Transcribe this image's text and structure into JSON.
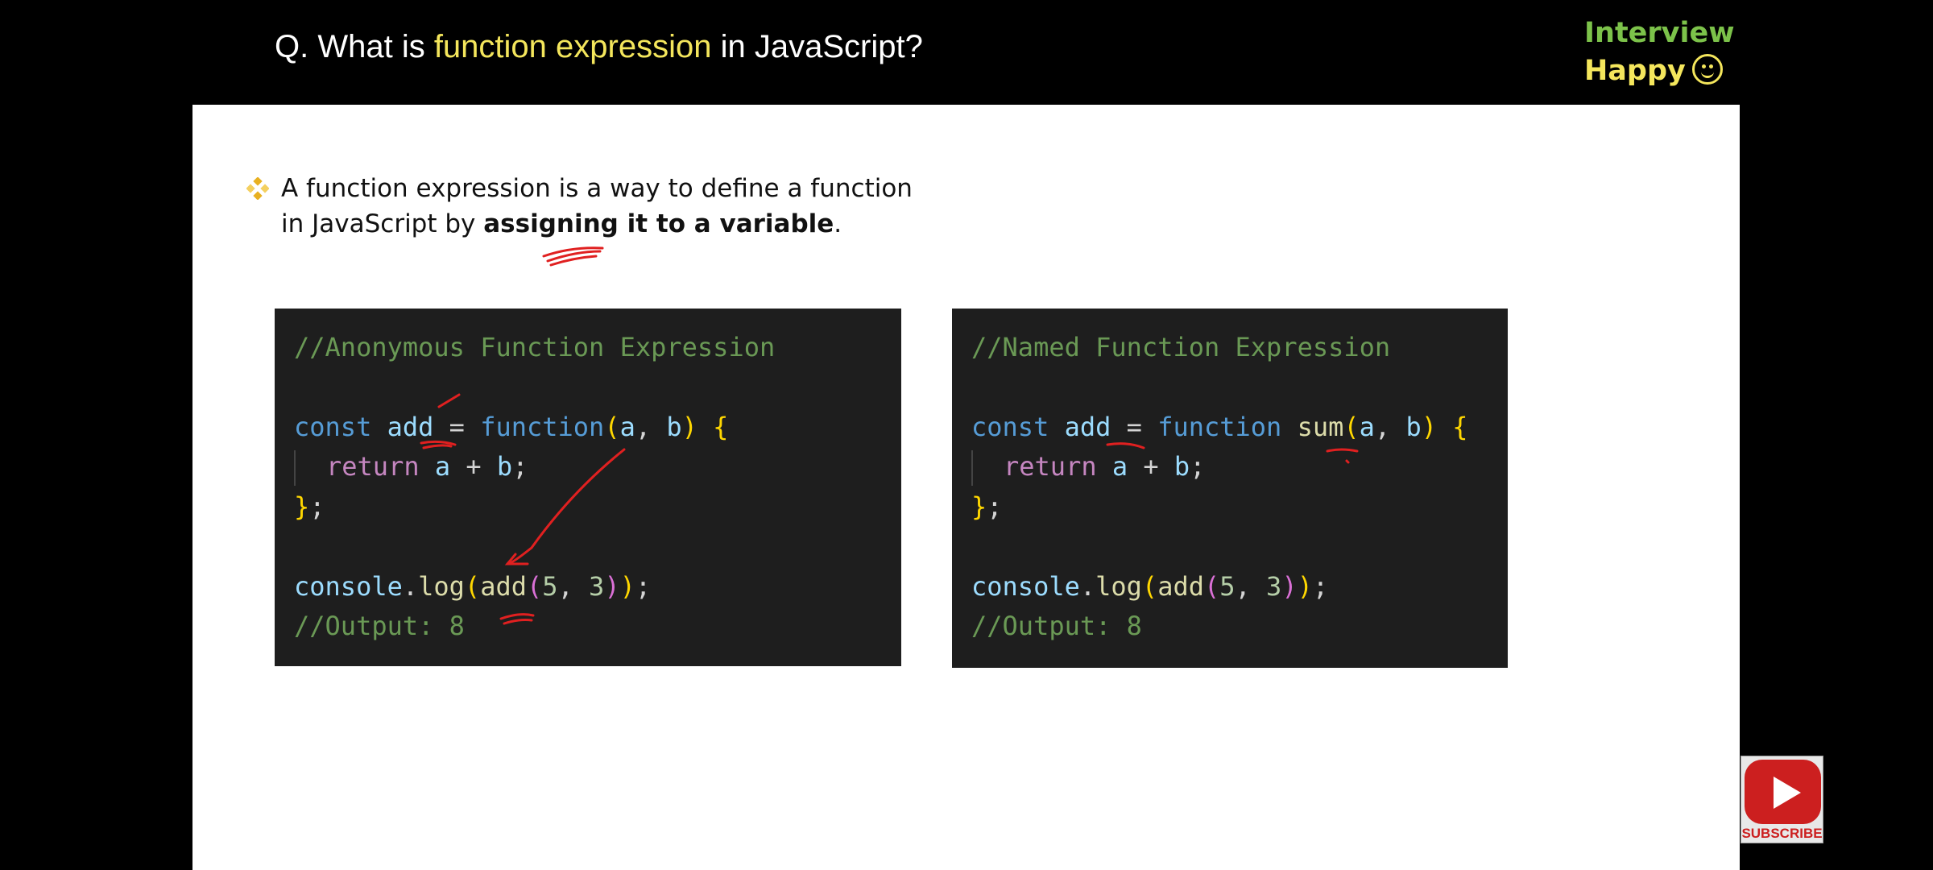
{
  "header": {
    "title_prefix": "Q. What is ",
    "title_highlight": "function expression",
    "title_suffix": " in JavaScript?",
    "brand_line1": "Interview",
    "brand_line2": "Happy"
  },
  "slide": {
    "bullet_line1": "A function expression is a way to define a function",
    "bullet_line2_prefix": "in JavaScript by ",
    "bullet_line2_bold": "assigning it to a variable",
    "bullet_line2_suffix": "."
  },
  "code_anonymous": {
    "comment": "//Anonymous Function Expression",
    "decl_const": "const",
    "decl_name": "add",
    "decl_eq": "=",
    "decl_function": "function",
    "params_a": "a",
    "params_b": "b",
    "body_return": "return",
    "body_expr_a": "a",
    "body_expr_op": "+",
    "body_expr_b": "b",
    "closing": "};",
    "log_object": "console",
    "log_method": "log",
    "log_callee": "add",
    "log_arg1": "5",
    "log_arg2": "3",
    "output": "//Output: 8"
  },
  "code_named": {
    "comment": "//Named Function Expression",
    "decl_const": "const",
    "decl_name": "add",
    "decl_eq": "=",
    "decl_function": "function",
    "decl_fn_name": "sum",
    "params_a": "a",
    "params_b": "b",
    "body_return": "return",
    "body_expr_a": "a",
    "body_expr_op": "+",
    "body_expr_b": "b",
    "closing": "};",
    "log_object": "console",
    "log_method": "log",
    "log_callee": "add",
    "log_arg1": "5",
    "log_arg2": "3",
    "output": "//Output: 8"
  },
  "subscribe": {
    "label": "SUBSCRIBE",
    "icon": "youtube-play-icon"
  },
  "colors": {
    "highlight_yellow": "#f4e65c",
    "brand_green": "#7cc24a",
    "code_bg": "#1e1e1e",
    "annotation_red": "#e02020"
  }
}
